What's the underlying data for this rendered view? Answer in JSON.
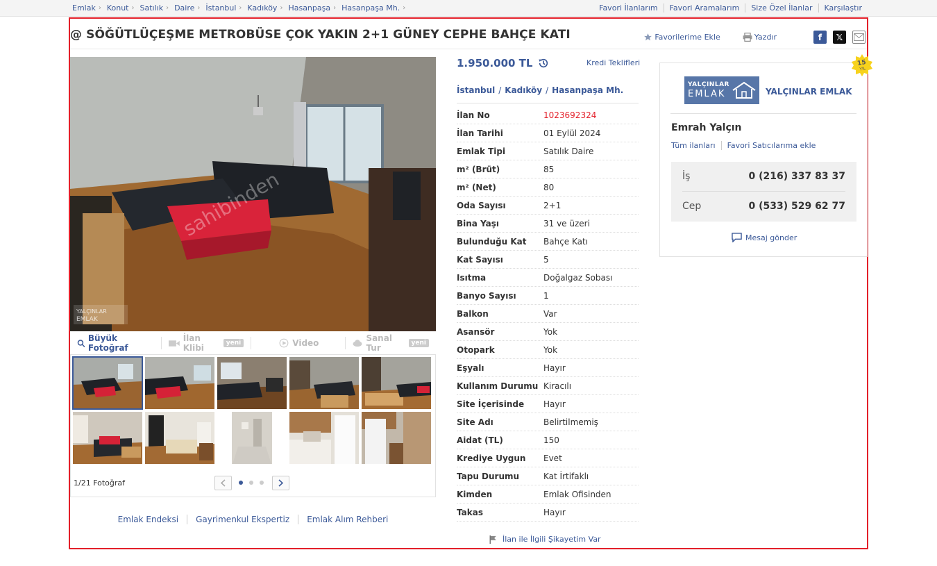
{
  "breadcrumb": [
    "Emlak",
    "Konut",
    "Satılık",
    "Daire",
    "İstanbul",
    "Kadıköy",
    "Hasanpaşa",
    "Hasanpaşa Mh."
  ],
  "top_links": [
    "Favori İlanlarım",
    "Favori Aramalarım",
    "Size Özel İlanlar",
    "Karşılaştır"
  ],
  "listing": {
    "title": "@ SÖĞÜTLÜÇEŞME METROBÜSE ÇOK YAKIN 2+1 GÜNEY CEPHE BAHÇE KATI",
    "favorite_label": "Favorilerime Ekle",
    "print_label": "Yazdır",
    "price": "1.950.000 TL",
    "credit_label": "Kredi Teklifleri",
    "location": [
      "İstanbul",
      "Kadıköy",
      "Hasanpaşa Mh."
    ]
  },
  "media": {
    "big_photo": "Büyük Fotoğraf",
    "video_clip": "İlan Klibi",
    "video": "Video",
    "virtual_tour": "Sanal Tur",
    "new_badge": "yeni",
    "counter": "1/21 Fotoğraf"
  },
  "watermark": {
    "site": "sahibinden",
    "agency_top": "YALÇINLAR",
    "agency_bottom": "EMLAK"
  },
  "details": [
    {
      "key": "İlan No",
      "value": "1023692324"
    },
    {
      "key": "İlan Tarihi",
      "value": "01 Eylül 2024"
    },
    {
      "key": "Emlak Tipi",
      "value": "Satılık Daire"
    },
    {
      "key": "m² (Brüt)",
      "value": "85"
    },
    {
      "key": "m² (Net)",
      "value": "80"
    },
    {
      "key": "Oda Sayısı",
      "value": "2+1"
    },
    {
      "key": "Bina Yaşı",
      "value": "31 ve üzeri"
    },
    {
      "key": "Bulunduğu Kat",
      "value": "Bahçe Katı"
    },
    {
      "key": "Kat Sayısı",
      "value": "5"
    },
    {
      "key": "Isıtma",
      "value": "Doğalgaz Sobası"
    },
    {
      "key": "Banyo Sayısı",
      "value": "1"
    },
    {
      "key": "Balkon",
      "value": "Var"
    },
    {
      "key": "Asansör",
      "value": "Yok"
    },
    {
      "key": "Otopark",
      "value": "Yok"
    },
    {
      "key": "Eşyalı",
      "value": "Hayır"
    },
    {
      "key": "Kullanım Durumu",
      "value": "Kiracılı"
    },
    {
      "key": "Site İçerisinde",
      "value": "Hayır"
    },
    {
      "key": "Site Adı",
      "value": "Belirtilmemiş"
    },
    {
      "key": "Aidat (TL)",
      "value": "150"
    },
    {
      "key": "Krediye Uygun",
      "value": "Evet"
    },
    {
      "key": "Tapu Durumu",
      "value": "Kat İrtifaklı"
    },
    {
      "key": "Kimden",
      "value": "Emlak Ofisinden"
    },
    {
      "key": "Takas",
      "value": "Hayır"
    }
  ],
  "complaint": "İlan ile İlgili Şikayetim Var",
  "footer_links": [
    "Emlak Endeksi",
    "Gayrimenkul Ekspertiz",
    "Emlak Alım Rehberi"
  ],
  "seller": {
    "badge_number": "15",
    "badge_unit": "YIL",
    "logo_top": "YALÇINLAR",
    "logo_bottom": "EMLAK",
    "store_name": "YALÇINLAR EMLAK",
    "agent_name": "Emrah Yalçın",
    "all_listings": "Tüm ilanları",
    "add_favorite": "Favori Satıcılarıma ekle",
    "phones": [
      {
        "label": "İş",
        "number": "0 (216) 337 83 37"
      },
      {
        "label": "Cep",
        "number": "0 (533) 529 62 77"
      }
    ],
    "message": "Mesaj gönder"
  },
  "colors": {
    "accent": "#3b5998",
    "highlight": "#e3202a"
  }
}
